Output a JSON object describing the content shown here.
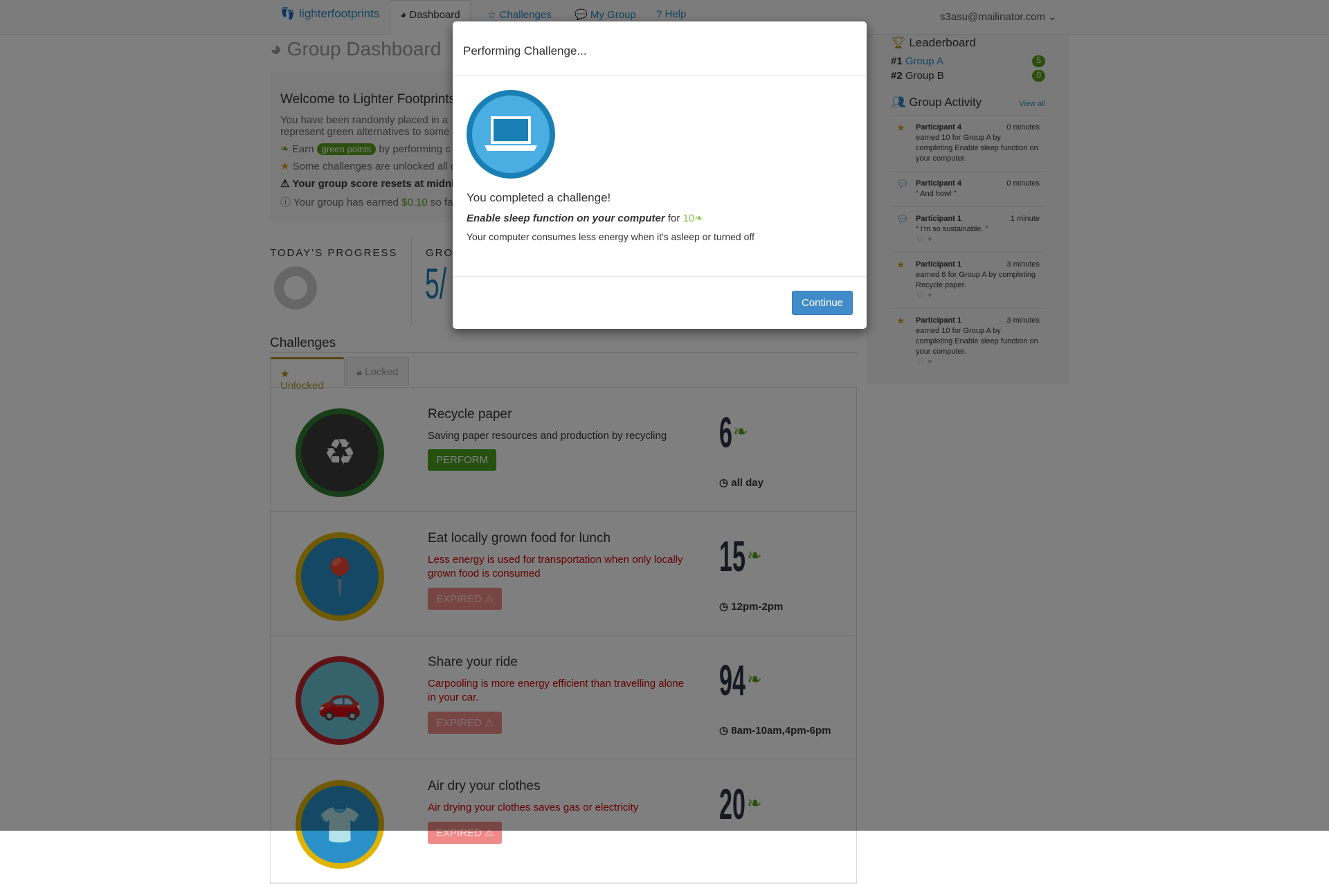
{
  "nav": {
    "logo": "lighterfootprints",
    "tabs": [
      "Dashboard",
      "Challenges",
      "My Group",
      "Help"
    ],
    "user": "s3asu@mailinator.com"
  },
  "page": {
    "title": "Group Dashboard"
  },
  "welcome": {
    "heading": "Welcome to Lighter Footprints",
    "line1": "You have been randomly placed in a",
    "line2": "represent green alternatives to some",
    "earn_pre": "Earn",
    "earn_badge": "green points",
    "earn_post": "by performing c",
    "unlock": "Some challenges are unlocked all d",
    "reset": "Your group score resets at midnigh",
    "earned_pre": "Your group has earned",
    "earned_amount": "$0.10",
    "earned_post": "so fa"
  },
  "progress": {
    "label": "TODAY'S PROGRESS",
    "fraction": 0.02
  },
  "score": {
    "label": "GROU",
    "value": "5/"
  },
  "challenges": {
    "heading": "Challenges",
    "tabs": [
      "Unlocked",
      "Locked"
    ],
    "items": [
      {
        "title": "Recycle paper",
        "desc": "Saving paper resources and production by recycling",
        "status": "PERFORM",
        "points": "6",
        "time": "all day",
        "color": "#2e7d32",
        "bg": "#3a3a3a",
        "icon": "recycle-icon",
        "glyph": "♻"
      },
      {
        "title": "Eat locally grown food for lunch",
        "desc": "Less energy is used for transportation when only locally grown food is consumed",
        "status": "EXPIRED",
        "points": "15",
        "time": "12pm-2pm",
        "color": "#e0b400",
        "bg": "#2a90c8",
        "icon": "map-pin-icon",
        "glyph": "📍"
      },
      {
        "title": "Share your ride",
        "desc": "Carpooling is more energy efficient than travelling alone in your car.",
        "status": "EXPIRED",
        "points": "94",
        "time": "8am-10am,4pm-6pm",
        "color": "#c0262c",
        "bg": "#6cc4d8",
        "icon": "car-icon",
        "glyph": "🚗"
      },
      {
        "title": "Air dry your clothes",
        "desc": "Air drying your clothes saves gas or electricity",
        "status": "EXPIRED",
        "points": "20",
        "time": "",
        "color": "#e0b400",
        "bg": "#2a90c8",
        "icon": "shirt-icon",
        "glyph": "👕"
      }
    ]
  },
  "leaderboard": {
    "title": "Leaderboard",
    "entries": [
      {
        "rank": "#1",
        "name": "Group A",
        "score": "5"
      },
      {
        "rank": "#2",
        "name": "Group B",
        "score": "0"
      }
    ]
  },
  "activity": {
    "title": "Group Activity",
    "view_all": "View all",
    "items": [
      {
        "type": "star",
        "who": "Participant 4",
        "when": "0 minutes",
        "text": "earned 10 for Group A by completing Enable sleep function on your computer."
      },
      {
        "type": "comment",
        "who": "Participant 4",
        "when": "0 minutes",
        "text": "“ And how! ”"
      },
      {
        "type": "comment",
        "who": "Participant 1",
        "when": "1 minute",
        "text": "“ I'm so sustainable. ”"
      },
      {
        "type": "star",
        "who": "Participant 1",
        "when": "3 minutes",
        "text": "earned 6 for Group A by completing Recycle paper."
      },
      {
        "type": "star",
        "who": "Participant 1",
        "when": "3 minutes",
        "text": "earned 10 for Group A by completing Enable sleep function on your computer."
      }
    ]
  },
  "modal": {
    "title": "Performing Challenge...",
    "completed": "You completed a challenge!",
    "challenge": "Enable sleep function on your computer",
    "for": "for",
    "points": "10",
    "desc": "Your computer consumes less energy when it's asleep or turned off",
    "continue": "Continue"
  }
}
